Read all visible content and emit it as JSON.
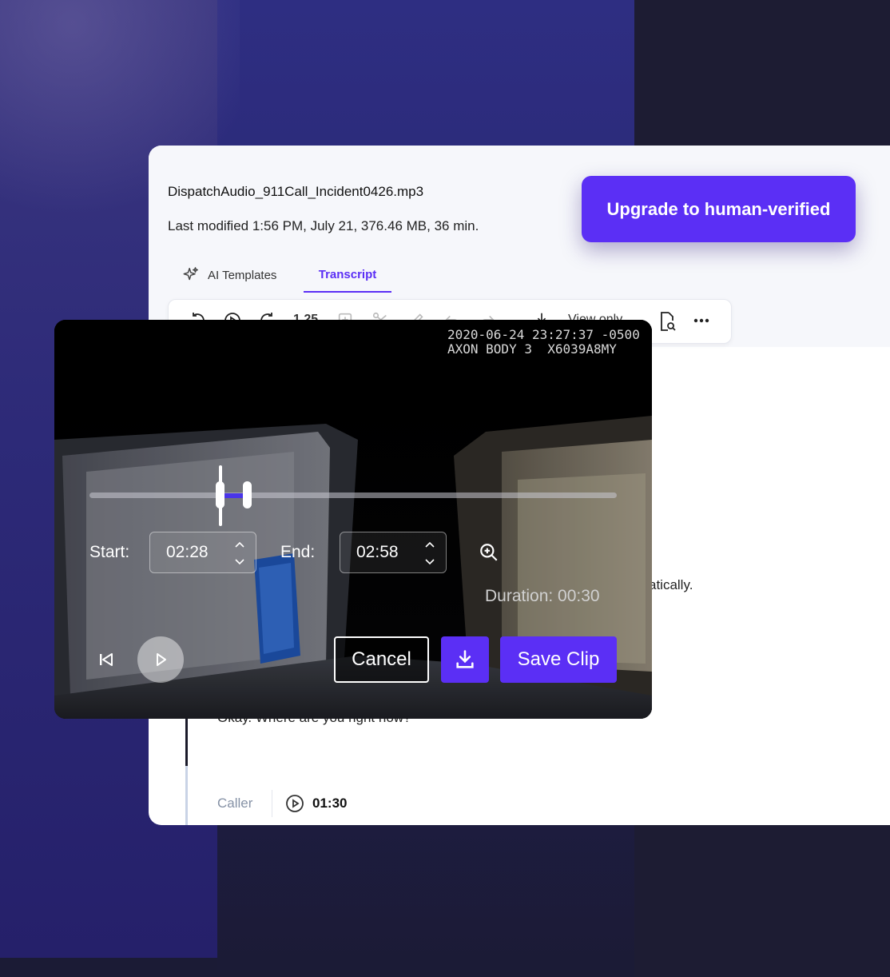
{
  "file": {
    "name": "DispatchAudio_911Call_Incident0426.mp3",
    "meta": "Last modified 1:56 PM, July 21, 376.46 MB, 36 min."
  },
  "header": {
    "upgrade_label": "Upgrade to human-verified"
  },
  "tabs": [
    {
      "label": "AI Templates",
      "icon": "sparkle-icon"
    },
    {
      "label": "Transcript",
      "active": true
    }
  ],
  "toolbar": {
    "speed": "1.25",
    "view_mode": "View only",
    "icons": [
      "rewind-icon",
      "play-icon",
      "forward-icon",
      "insert-icon",
      "scissors-icon",
      "pen-icon",
      "undo-icon",
      "redo-icon",
      "download-icon",
      "document-search-icon",
      "more-icon"
    ]
  },
  "transcript": {
    "partial_line": "atically.",
    "quote": "Okay. Where are you right now?",
    "speaker": "Caller",
    "timestamp": "01:30"
  },
  "video": {
    "timestamp_line1": "2020-06-24 23:27:37 -0500",
    "timestamp_line2": "AXON BODY 3  X6039A8MY"
  },
  "clip": {
    "start_label": "Start:",
    "start_value": "02:28",
    "end_label": "End:",
    "end_value": "02:58",
    "duration": "Duration: 00:30",
    "cancel_label": "Cancel",
    "save_label": "Save Clip",
    "selection_start_fraction": 0.244,
    "selection_end_fraction": 0.296
  },
  "colors": {
    "accent": "#5b2ff5",
    "panel_bg": "#f6f7fb"
  }
}
